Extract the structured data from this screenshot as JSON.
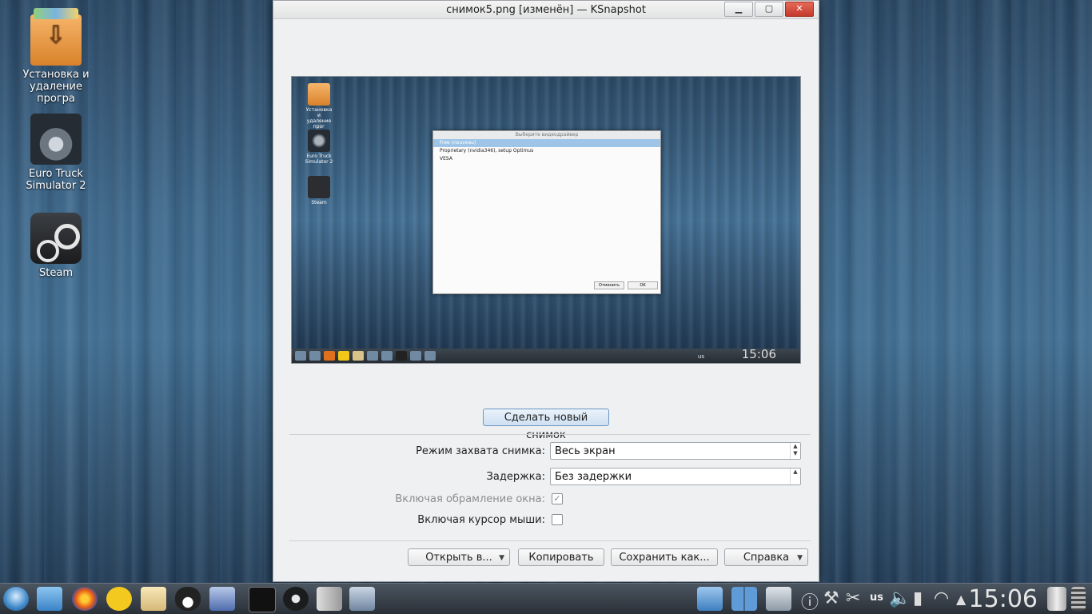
{
  "desktop": {
    "icons": [
      {
        "label": "Установка и удаление програ"
      },
      {
        "label": "Euro Truck Simulator 2"
      },
      {
        "label": "Steam"
      }
    ]
  },
  "window": {
    "title": "снимок5.png [изменён] — KSnapshot",
    "buttons": {
      "minimize": "▁",
      "maximize": "▢",
      "close": "✕"
    }
  },
  "preview": {
    "icons": [
      {
        "label": "Установка и удаление прог"
      },
      {
        "label": "Euro Truck Simulator 2"
      },
      {
        "label": "Steam"
      }
    ],
    "dialog": {
      "title": "Выберите видеодрайвер",
      "items": [
        "Free (nouveau)",
        "Proprietary (nvidia346), setup Optimus",
        "VESA"
      ],
      "cancel": "Отменить",
      "ok": "OK"
    },
    "lang": "us",
    "clock": "15:06"
  },
  "snapshot_button": "Сделать новый снимок",
  "form": {
    "mode_label": "Режим захвата снимка:",
    "mode_value": "Весь экран",
    "delay_label": "Задержка:",
    "delay_value": "Без задержки",
    "decorations_label": "Включая обрамление окна:",
    "decorations_checked": "✓",
    "cursor_label": "Включая курсор мыши:"
  },
  "footer": {
    "open": "Открыть в...",
    "copy": "Копировать",
    "save": "Сохранить как...",
    "help": "Справка",
    "dropdown": "▼"
  },
  "taskbar": {
    "lang": "us",
    "clock": "15:06"
  },
  "colors": {
    "accent": "#cfe0f2",
    "selection": "#9ec5e8"
  }
}
